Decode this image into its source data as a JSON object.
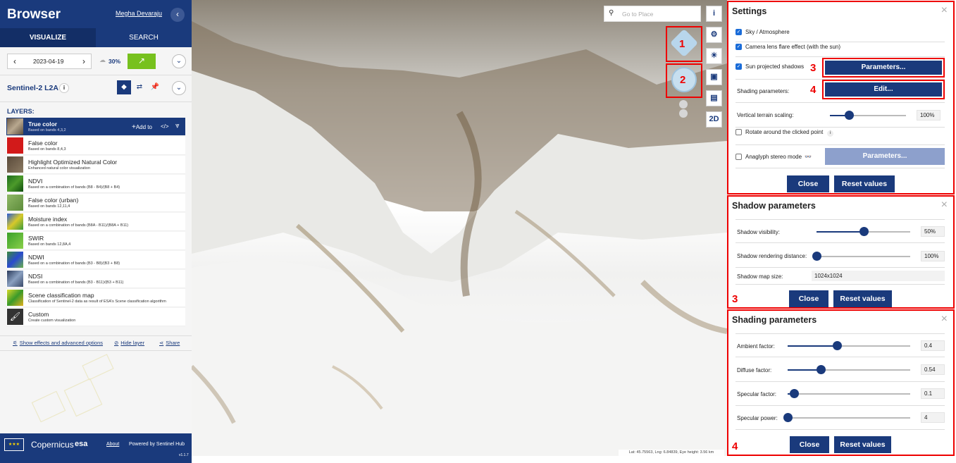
{
  "sidebar": {
    "app_title": "Browser",
    "user": "Megha Devaraju",
    "collapse_icon": "‹",
    "tabs": [
      "VISUALIZE",
      "SEARCH"
    ],
    "date": "2023-04-19",
    "cloud_coverage": "30%",
    "dataset": "Sentinel-2 L2A",
    "info_icon": "i",
    "layers_header": "LAYERS:",
    "layers": [
      {
        "title": "True color",
        "desc": "Based on bands 4,3,2",
        "selected": true
      },
      {
        "title": "False color",
        "desc": "Based on bands 8,4,3"
      },
      {
        "title": "Highlight Optimized Natural Color",
        "desc": "Enhanced natural color visualization"
      },
      {
        "title": "NDVI",
        "desc": "Based on a combination of bands (B8 - B4)/(B8 + B4)"
      },
      {
        "title": "False color (urban)",
        "desc": "Based on bands 12,11,4"
      },
      {
        "title": "Moisture index",
        "desc": "Based on a combination of bands (B8A - B11)/(B8A + B11)"
      },
      {
        "title": "SWIR",
        "desc": "Based on bands 12,8A,4"
      },
      {
        "title": "NDWI",
        "desc": "Based on a combination of bands (B3 - B8)/(B3 + B8)"
      },
      {
        "title": "NDSI",
        "desc": "Based on a combination of bands (B3 - B11)/(B3 + B11)"
      },
      {
        "title": "Scene classification map",
        "desc": "Classification of Sentinel-2 data as result of ESA's Scene classification algorithm"
      },
      {
        "title": "Custom",
        "desc": "Create custom visualization"
      }
    ],
    "add_to": "Add to",
    "code_icon": "</>",
    "effects_link": "Show effects and advanced options",
    "hide_layer": "Hide layer",
    "share": "Share",
    "footer": {
      "copernicus": "Copernicus",
      "esa": "esa",
      "about": "About",
      "powered": "Powered by Sentinel Hub",
      "version": "v1.1.7"
    }
  },
  "map": {
    "search_placeholder": "Go to Place",
    "coords": "Lat: 45.75563, Lng: 6.84839, Eye height: 3.56 km",
    "btn_2d": "2D",
    "annotations": [
      "1",
      "2",
      "3",
      "4",
      "3",
      "4"
    ]
  },
  "settings": {
    "title": "Settings",
    "close_icon": "×",
    "sky": "Sky / Atmosphere",
    "lens": "Camera lens flare effect (with the sun)",
    "shadows": "Sun projected shadows",
    "parameters_btn": "Parameters...",
    "shading_label": "Shading parameters:",
    "edit_btn": "Edit...",
    "vertical_label": "Vertical terrain scaling:",
    "vertical_value": "100%",
    "vertical_level": 0.25,
    "rotate_label": "Rotate around the clicked point",
    "anaglyph_label": "Anaglyph stereo mode",
    "close_btn": "Close",
    "reset_btn": "Reset values"
  },
  "shadow_params": {
    "title": "Shadow parameters",
    "visibility_label": "Shadow visibility:",
    "visibility_value": "50%",
    "visibility_level": 0.5,
    "distance_label": "Shadow rendering distance:",
    "distance_value": "100%",
    "distance_level": 0.0,
    "mapsize_label": "Shadow map size:",
    "mapsize_value": "1024x1024",
    "close_btn": "Close",
    "reset_btn": "Reset values"
  },
  "shading_params": {
    "title": "Shading parameters",
    "ambient_label": "Ambient factor:",
    "ambient_value": "0.4",
    "ambient_level": 0.4,
    "diffuse_label": "Diffuse factor:",
    "diffuse_value": "0.54",
    "diffuse_level": 0.27,
    "specular_label": "Specular factor:",
    "specular_value": "0.1",
    "specular_level": 0.05,
    "power_label": "Specular power:",
    "power_value": "4",
    "power_level": 0.0,
    "close_btn": "Close",
    "reset_btn": "Reset values"
  },
  "colors": {
    "primary": "#1a3a7c",
    "accent_green": "#77c11e",
    "annotation_red": "#e00000"
  }
}
